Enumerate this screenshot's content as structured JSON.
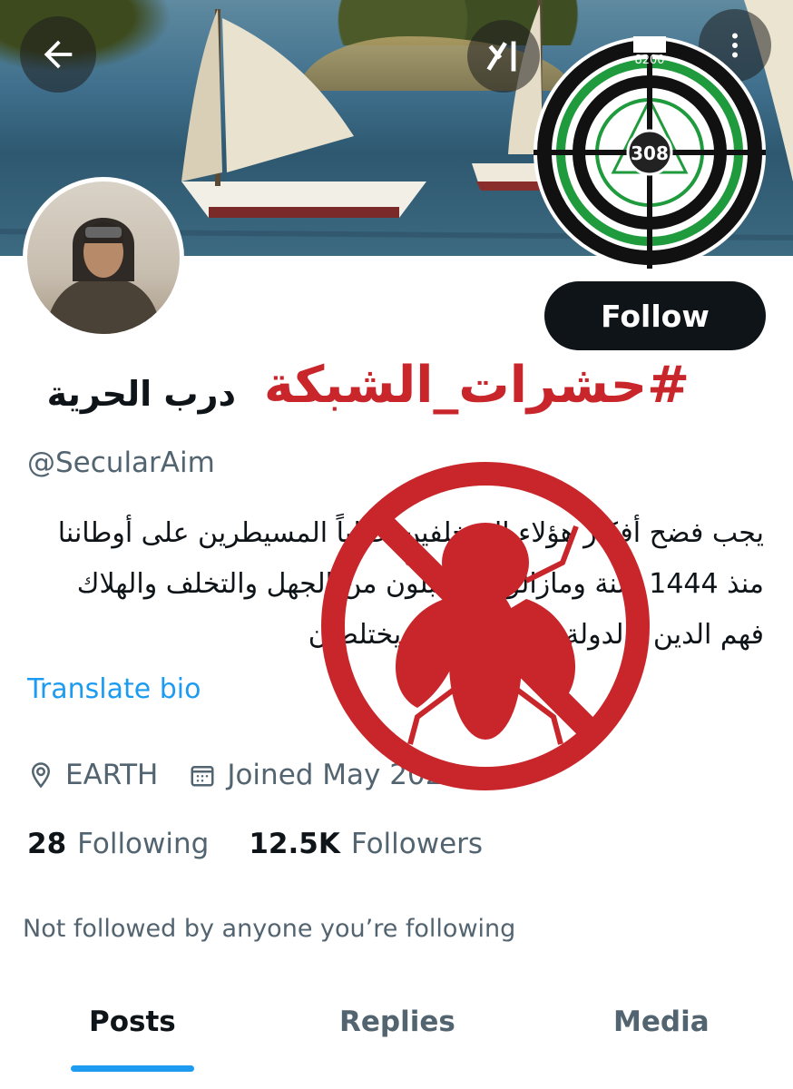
{
  "colors": {
    "accent": "#1d9bf0",
    "text_primary": "#0f1419",
    "text_secondary": "#536471",
    "follow_bg": "#0f1419",
    "overlay_red": "#c8262b",
    "logo_green": "#1f9a3c"
  },
  "header": {
    "back_icon": "arrow-left-icon",
    "grok_icon": "grok-icon",
    "more_icon": "more-vertical-icon"
  },
  "overlay_logo": {
    "top_text": "8200",
    "center_text": "308"
  },
  "profile": {
    "display_name": "درب الحرية",
    "handle": "@SecularAim",
    "follow_label": "Follow",
    "bio_lines": [
      "يجب فضح أفكار هؤلاء المتخلفين عقلياً المسيطرين على أوطاننا",
      "منذ 1444 سنة ومازالوا يستقبلون من الجهل والتخلف والهلاك",
      "فهم الدين والدولة بينهما برزخ لا يختلطان"
    ],
    "translate_label": "Translate bio",
    "location": "EARTH",
    "joined": "Joined May 2023",
    "following_count": "28",
    "following_label": "Following",
    "followers_count": "12.5K",
    "followers_label": "Followers",
    "not_followed_text": "Not followed by anyone you’re following"
  },
  "overlay_hashtag": "#حشرات_الشبكة",
  "tabs": [
    {
      "label": "Posts",
      "active": true
    },
    {
      "label": "Replies",
      "active": false
    },
    {
      "label": "Media",
      "active": false
    }
  ]
}
